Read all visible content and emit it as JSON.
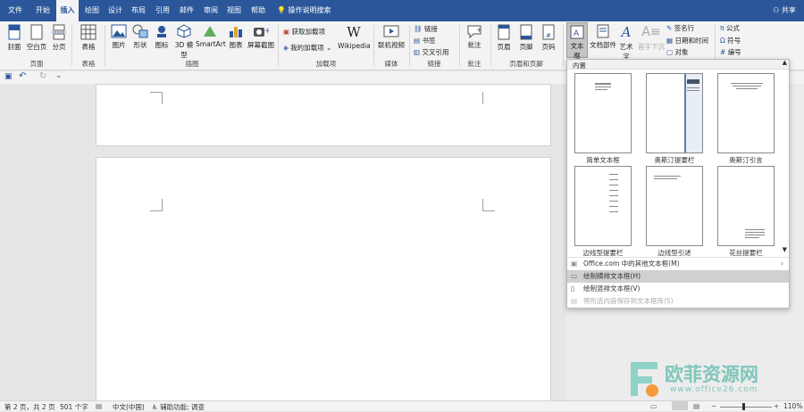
{
  "tabs": [
    "文件",
    "开始",
    "插入",
    "绘图",
    "设计",
    "布局",
    "引用",
    "邮件",
    "审阅",
    "视图",
    "帮助"
  ],
  "search_label": "操作说明搜索",
  "share_label": "共享",
  "ribbon": {
    "pages": {
      "cover": "封面",
      "blank": "空白页",
      "break": "分页",
      "group": "页面"
    },
    "tables": {
      "table": "表格",
      "group": "表格"
    },
    "illustrations": {
      "picture": "图片",
      "shapes": "形状",
      "icons": "图标",
      "model3d": "3D 模型",
      "smartart": "SmartArt",
      "chart": "图表",
      "screenshot": "屏幕截图",
      "group": "插图"
    },
    "addins": {
      "get": "获取加载项",
      "mine": "我的加载项",
      "wiki": "Wikipedia",
      "group": "加载项"
    },
    "media": {
      "video": "联机视频",
      "group": "媒体"
    },
    "links": {
      "link": "链接",
      "bookmark": "书签",
      "crossref": "交叉引用",
      "group": "链接"
    },
    "comments": {
      "comment": "批注",
      "group": "批注"
    },
    "headerfooter": {
      "header": "页眉",
      "footer": "页脚",
      "pagenum": "页码",
      "group": "页眉和页脚"
    },
    "text": {
      "textbox": "文本框",
      "docparts": "文档部件",
      "wordart": "艺术字",
      "dropcap": "首字下沉",
      "signature": "签名行",
      "datetime": "日期和时间",
      "object": "对象"
    },
    "symbols": {
      "equation": "公式",
      "symbol": "符号",
      "number": "编号"
    }
  },
  "dropdown": {
    "header": "内置",
    "thumbnails": [
      "简单文本框",
      "奥斯汀提要栏",
      "奥斯汀引言",
      "边线型提要栏",
      "边线型引述",
      "花丝提要栏"
    ],
    "items": [
      {
        "label": "Office.com 中的其他文本框(M)",
        "arrow": "›"
      },
      {
        "label": "绘制横排文本框(H)",
        "arrow": ""
      },
      {
        "label": "绘制竖排文本框(V)",
        "arrow": ""
      },
      {
        "label": "将所选内容保存到文本框库(S)",
        "arrow": ""
      }
    ]
  },
  "status": {
    "page": "第 2 页，共 2 页",
    "words": "501 个字",
    "lang": "中文(中国)",
    "access": "辅助功能: 调查",
    "zoom": "110%"
  },
  "watermark": {
    "cn": "欧菲资源网",
    "url": "www.office26.com"
  }
}
